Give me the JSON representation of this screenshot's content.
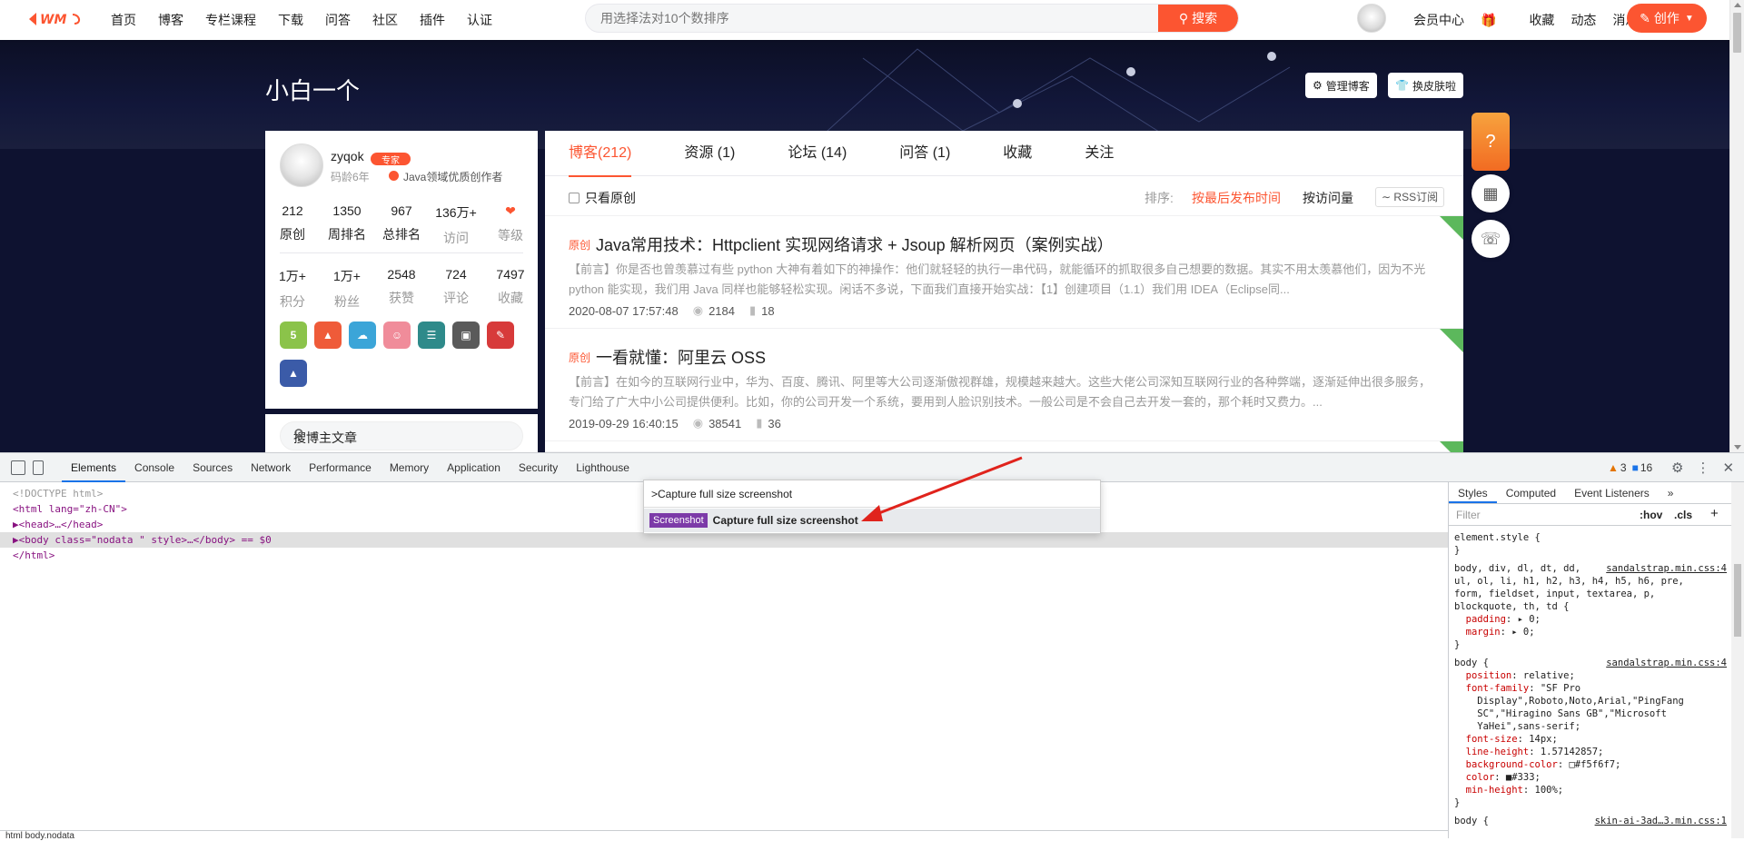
{
  "topnav": {
    "links": [
      "首页",
      "博客",
      "专栏课程",
      "下载",
      "问答",
      "社区",
      "插件",
      "认证"
    ],
    "search_placeholder": "用选择法对10个数排序",
    "search_button": "搜索",
    "right_links": [
      "会员中心",
      "收藏",
      "动态",
      "消息"
    ],
    "create_button": "创作"
  },
  "banner": {
    "title": "小白一个",
    "manage_button": "管理博客",
    "skin_button": "换皮肤啦"
  },
  "profile": {
    "name": "zyqok",
    "expert_badge": "专家",
    "code_age": "码龄6年",
    "creator": "Java领域优质创作者",
    "stats_row1": [
      {
        "value": "212",
        "label": "原创"
      },
      {
        "value": "1350",
        "label": "周排名"
      },
      {
        "value": "967",
        "label": "总排名"
      },
      {
        "value": "136万+",
        "label": "访问"
      },
      {
        "value": "",
        "label": "等级"
      }
    ],
    "stats_row2": [
      {
        "value": "1万+",
        "label": "积分"
      },
      {
        "value": "1万+",
        "label": "粉丝"
      },
      {
        "value": "2548",
        "label": "获赞"
      },
      {
        "value": "724",
        "label": "评论"
      },
      {
        "value": "7497",
        "label": "收藏"
      }
    ],
    "search_placeholder": "搜博主文章"
  },
  "tabs": [
    "博客(212)",
    "资源 (1)",
    "论坛 (14)",
    "问答 (1)",
    "收藏",
    "关注"
  ],
  "filter": {
    "only_original": "只看原创",
    "sort_label": "排序:",
    "sort_latest": "按最后发布时间",
    "sort_views": "按访问量",
    "rss": "RSS订阅"
  },
  "articles": [
    {
      "tag": "原创",
      "title": "Java常用技术：Httpclient 实现网络请求 + Jsoup 解析网页（案例实战）",
      "desc": "【前言】你是否也曾羡慕过有些 python 大神有着如下的神操作：他们就轻轻的执行一串代码，就能循环的抓取很多自己想要的数据。其实不用太羡慕他们，因为不光 python 能实现，我们用 Java 同样也能够轻松实现。闲话不多说，下面我们直接开始实战：【1】创建项目（1.1）我们用 IDEA（Eclipse同...",
      "date": "2020-08-07 17:57:48",
      "views": "2184",
      "comments": "18"
    },
    {
      "tag": "原创",
      "title": "一看就懂：阿里云 OSS",
      "desc": "【前言】在如今的互联网行业中，华为、百度、腾讯、阿里等大公司逐渐傲视群雄，规模越来越大。这些大佬公司深知互联网行业的各种弊端，逐渐延伸出很多服务，专门给了广大中小公司提供便利。比如，你的公司开发一个系统，要用到人脸识别技术。一般公司是不会自己去开发一套的，那个耗时又费力。...",
      "date": "2019-09-29 16:40:15",
      "views": "38541",
      "comments": "36"
    }
  ],
  "devtools": {
    "tabs": [
      "Elements",
      "Console",
      "Sources",
      "Network",
      "Performance",
      "Memory",
      "Application",
      "Security",
      "Lighthouse"
    ],
    "warnings": "3",
    "messages": "16",
    "dom_lines": [
      "<!DOCTYPE html>",
      "<html lang=\"zh-CN\">",
      "▶<head>…</head>",
      "▶<body class=\"nodata \" style>…</body> == $0",
      "</html>"
    ],
    "command_input": ">Capture full size screenshot",
    "command_tag": "Screenshot",
    "command_text": "Capture full size screenshot",
    "styles_tabs": [
      "Styles",
      "Computed",
      "Event Listeners"
    ],
    "filter_placeholder": "Filter",
    "hov": ":hov",
    "cls": ".cls",
    "breadcrumb": "html  body.nodata"
  },
  "colors": {
    "accent": "#fc5531",
    "devtools_blue": "#1a73e8",
    "screenshot_tag": "#7c3aa8"
  }
}
